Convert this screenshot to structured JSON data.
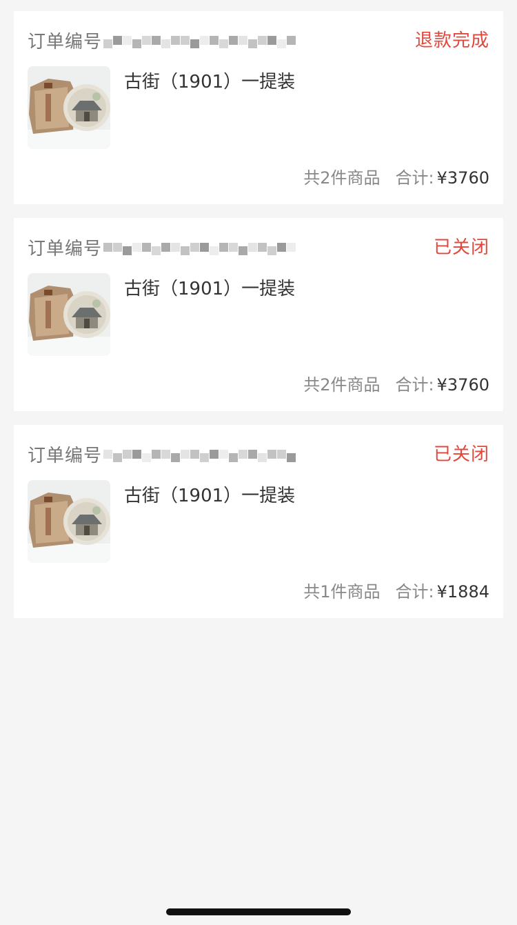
{
  "orders": [
    {
      "order_no_label": "订单编号",
      "status": "退款完成",
      "product_name": "古街（1901）一提装",
      "item_count": "共2件商品",
      "total_label": "合计:",
      "total_price": "¥3760",
      "image_icon": "tea-cake-icon"
    },
    {
      "order_no_label": "订单编号",
      "status": "已关闭",
      "product_name": "古街（1901）一提装",
      "item_count": "共2件商品",
      "total_label": "合计:",
      "total_price": "¥3760",
      "image_icon": "tea-cake-icon"
    },
    {
      "order_no_label": "订单编号",
      "status": "已关闭",
      "product_name": "古街（1901）一提装",
      "item_count": "共1件商品",
      "total_label": "合计:",
      "total_price": "¥1884",
      "image_icon": "tea-cake-icon"
    }
  ],
  "colors": {
    "status_red": "#e2473b",
    "background": "#f5f5f5",
    "card": "#ffffff"
  }
}
